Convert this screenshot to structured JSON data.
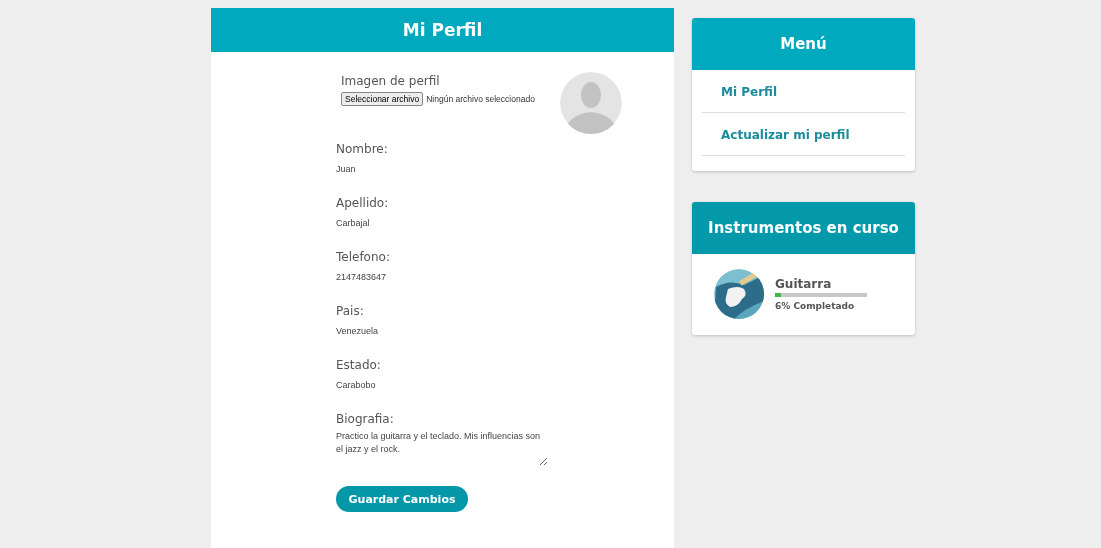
{
  "profile": {
    "title": "Mi Perfil",
    "image_label": "Imagen de perfil",
    "file_button": "Seleccionar archivo",
    "file_status": "Ningún archivo seleccionado",
    "fields": [
      {
        "label": "Nombre:",
        "value": "Juan"
      },
      {
        "label": "Apellido:",
        "value": "Carbajal"
      },
      {
        "label": "Telefono:",
        "value": "2147483647"
      },
      {
        "label": "Pais:",
        "value": "Venezuela"
      },
      {
        "label": "Estado:",
        "value": "Carabobo"
      }
    ],
    "bio": {
      "label": "Biografia:",
      "value": "Practico la guitarra y el teclado. Mis influencias son el jazz y el rock."
    },
    "save_button": "Guardar Cambios"
  },
  "menu": {
    "title": "Menú",
    "items": [
      {
        "label": "Mi Perfil"
      },
      {
        "label": "Actualizar mi perfil"
      }
    ]
  },
  "instruments": {
    "title": "Instrumentos en curso",
    "items": [
      {
        "name": "Guitarra",
        "level": 0.06,
        "progress": "6% Completado"
      }
    ]
  }
}
